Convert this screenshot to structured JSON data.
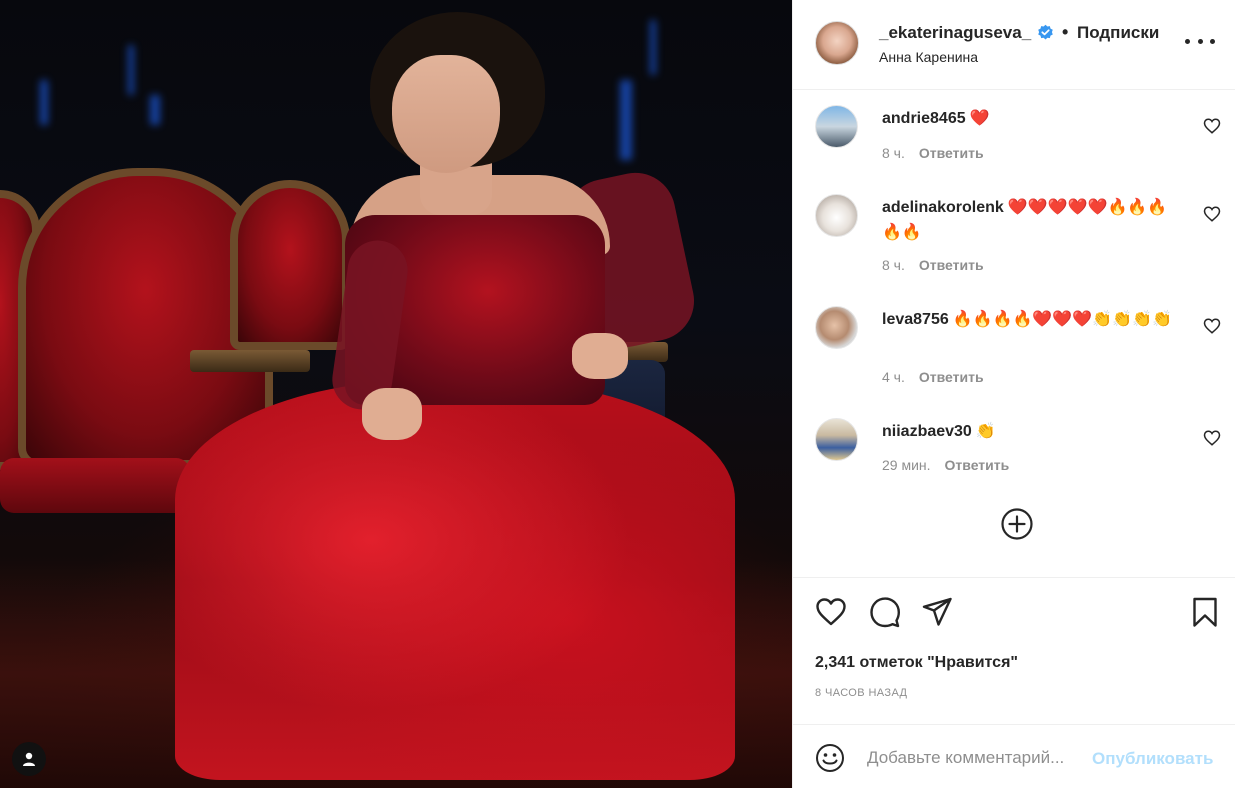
{
  "post": {
    "username": "_ekaterinaguseva_",
    "verified": true,
    "separator": "•",
    "follow_state": "Подписки",
    "location": "Анна Каренина"
  },
  "comments": [
    {
      "username": "andrie8465",
      "text": "❤️",
      "time": "8 ч.",
      "reply": "Ответить"
    },
    {
      "username": "adelinakorolenk",
      "text": "❤️❤️❤️❤️❤️🔥🔥🔥🔥🔥",
      "time": "8 ч.",
      "reply": "Ответить"
    },
    {
      "username": "leva8756",
      "text": "🔥🔥🔥🔥❤️❤️❤️👏👏👏👏",
      "time": "4 ч.",
      "reply": "Ответить"
    },
    {
      "username": "niiazbaev30",
      "text": "👏",
      "time": "29 мин.",
      "reply": "Ответить"
    }
  ],
  "actions": {
    "likes_text": "2,341 отметок \"Нравится\"",
    "posted_ago": "8 часов назад"
  },
  "add_comment": {
    "placeholder": "Добавьте комментарий...",
    "publish_label": "Опубликовать"
  },
  "colors": {
    "text": "#262626",
    "muted": "#8e8e8e",
    "publish_disabled": "#b2dffc",
    "verified_blue": "#3897f0",
    "heart_red": "#ed4956"
  },
  "icons": [
    "verified-badge-icon",
    "more-options-icon",
    "heart-icon",
    "comment-icon",
    "share-icon",
    "bookmark-icon",
    "plus-circle-icon",
    "emoji-icon",
    "user-icon"
  ]
}
